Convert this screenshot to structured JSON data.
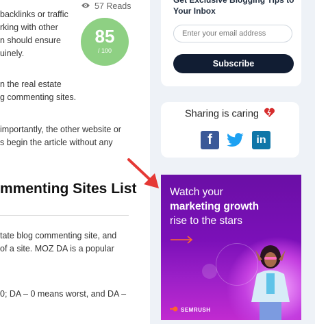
{
  "article": {
    "p1": [
      "backlinks or traffic",
      "rking with other",
      "n should ensure",
      "uinely."
    ],
    "p2": [
      "n the real estate",
      "g commenting sites."
    ],
    "p3": [
      "importantly, the other website or",
      "s begin the article without any"
    ],
    "heading": "mmenting Sites List",
    "p4": [
      "tate blog commenting site, and",
      "of a site. MOZ DA is a popular"
    ],
    "p5": [
      "0; DA – 0 means worst, and DA –"
    ]
  },
  "reads": {
    "icon": "eye-icon",
    "count": "57 Reads"
  },
  "score": {
    "value": "85",
    "max": "/ 100",
    "color": "#8ed083"
  },
  "newsletter": {
    "title": "Get Exclusive Blogging Tips to Your Inbox",
    "email_placeholder": "Enter your email address",
    "subscribe_label": "Subscribe",
    "button_color": "#111d33"
  },
  "share": {
    "title": "Sharing is caring",
    "heart_icon": "heart-icon",
    "buttons": [
      {
        "icon": "facebook-icon",
        "glyph": "f",
        "color": "#3b5998"
      },
      {
        "icon": "twitter-icon",
        "glyph": "",
        "color": "#1da1f2"
      },
      {
        "icon": "linkedin-icon",
        "glyph": "in",
        "color": "#0e76a8"
      }
    ]
  },
  "ad": {
    "line1": "Watch your",
    "line2": "marketing growth",
    "line3": "rise to the stars",
    "brand": "SEMRUSH",
    "arrow_icon": "arrow-right-icon"
  },
  "annotation": {
    "arrow_icon": "red-arrow-icon",
    "color": "#e53935"
  }
}
